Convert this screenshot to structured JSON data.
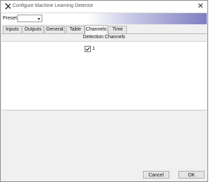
{
  "window": {
    "title": "Configure Machine Learning Detector",
    "close_glyph": "✕",
    "icon": "app-logo-icon"
  },
  "preset": {
    "label": "Preset:",
    "value": ""
  },
  "tabs": [
    {
      "label": "Inputs",
      "selected": false
    },
    {
      "label": "Outputs",
      "selected": false
    },
    {
      "label": "General",
      "selected": false
    },
    {
      "label": "Table",
      "selected": false
    },
    {
      "label": "Channels",
      "selected": true
    },
    {
      "label": "Time",
      "selected": false
    }
  ],
  "channels_panel": {
    "title": "Detection Channels",
    "items": [
      {
        "label": "1",
        "checked": true
      }
    ]
  },
  "buttons": {
    "cancel": "Cancel",
    "ok": "OK"
  }
}
